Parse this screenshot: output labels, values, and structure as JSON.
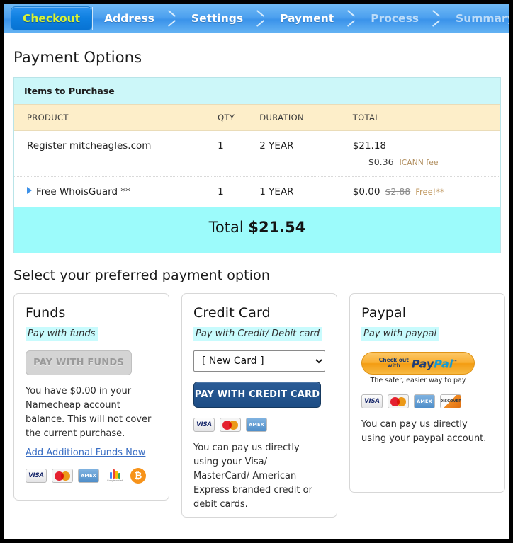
{
  "breadcrumb": {
    "steps": [
      {
        "label": "Checkout",
        "state": "active"
      },
      {
        "label": "Address",
        "state": "done"
      },
      {
        "label": "Settings",
        "state": "done"
      },
      {
        "label": "Payment",
        "state": "done"
      },
      {
        "label": "Process",
        "state": "disabled"
      },
      {
        "label": "Summary",
        "state": "disabled"
      }
    ]
  },
  "page": {
    "title": "Payment Options",
    "section_title": "Select your preferred payment option"
  },
  "items": {
    "header": "Items to Purchase",
    "columns": {
      "product": "PRODUCT",
      "qty": "QTY",
      "duration": "DURATION",
      "total": "TOTAL"
    },
    "rows": [
      {
        "product": "Register mitcheagles.com",
        "qty": "1",
        "duration": "2 YEAR",
        "total": "$21.18",
        "sub_total": "$0.36",
        "sub_note": "ICANN fee"
      },
      {
        "product": "Free WhoisGuard **",
        "qty": "1",
        "duration": "1 YEAR",
        "total": "$0.00",
        "strike": "$2.88",
        "free_tag": "Free!**"
      }
    ],
    "total_label": "Total",
    "total_amount": "$21.54"
  },
  "payment_options": {
    "funds": {
      "title": "Funds",
      "tagline": "Pay with funds",
      "button": "PAY WITH FUNDS",
      "button_disabled": true,
      "blurb": "You have $0.00 in your Namecheap account balance. This will not cover the current purchase.",
      "link": "Add Additional Funds Now",
      "brands": [
        "visa",
        "mastercard",
        "amex",
        "google-wallet",
        "bitcoin"
      ]
    },
    "credit_card": {
      "title": "Credit Card",
      "tagline": "Pay with Credit/ Debit card",
      "select_value": "[ New Card ]",
      "select_options": [
        "[ New Card ]"
      ],
      "button": "PAY WITH CREDIT CARD",
      "brands": [
        "visa",
        "mastercard",
        "amex"
      ],
      "blurb": "You can pay us directly using your Visa/ MasterCard/ American Express branded credit or debit cards."
    },
    "paypal": {
      "title": "Paypal",
      "tagline": "Pay with paypal",
      "button_check": "Check out",
      "button_with": "with",
      "button_logo_pay": "Pay",
      "button_logo_pal": "Pal",
      "button_tagline": "The safer, easier way to pay",
      "brands": [
        "visa",
        "mastercard",
        "amex",
        "discover"
      ],
      "blurb": "You can pay us directly using your paypal account."
    }
  },
  "brand_labels": {
    "visa": "VISA",
    "amex": "AMEX",
    "discover": "DISCOVER",
    "bitcoin": "₿",
    "google_wallet": "Google wallet"
  },
  "colors": {
    "breadcrumb_blue": "#4ea1ef",
    "active_tab_text": "#d8f236",
    "items_header_cyan": "#ccf7f9",
    "table_header_cream": "#fdeec9",
    "total_band": "#9cfbfb",
    "primary_button": "#1d4d85",
    "link": "#3b6fc4",
    "icann_fee": "#b08d5d"
  }
}
